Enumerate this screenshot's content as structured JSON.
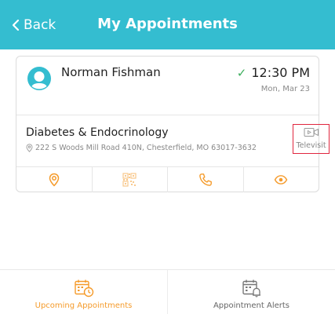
{
  "header": {
    "back_label": "Back",
    "title": "My Appointments",
    "background_color": "#34bdd0"
  },
  "appointment": {
    "patient_name": "Norman Fishman",
    "time": "12:30 PM",
    "date": "Mon, Mar 23",
    "status_icon": "check-icon",
    "status_color": "#3cae5c",
    "department": "Diabetes & Endocrinology",
    "address": "222 S Woods Mill Road 410N, Chesterfield, MO 63017-3632",
    "visit_type": "Televisit",
    "actions": [
      {
        "name": "location-pin-icon"
      },
      {
        "name": "qr-code-icon"
      },
      {
        "name": "phone-icon"
      },
      {
        "name": "eye-icon"
      }
    ]
  },
  "tabs": [
    {
      "label": "Upcoming Appointments",
      "active": true,
      "icon": "calendar-clock-icon",
      "color": "#f59b2b"
    },
    {
      "label": "Appointment Alerts",
      "active": false,
      "icon": "calendar-bell-icon",
      "color": "#666666"
    }
  ]
}
